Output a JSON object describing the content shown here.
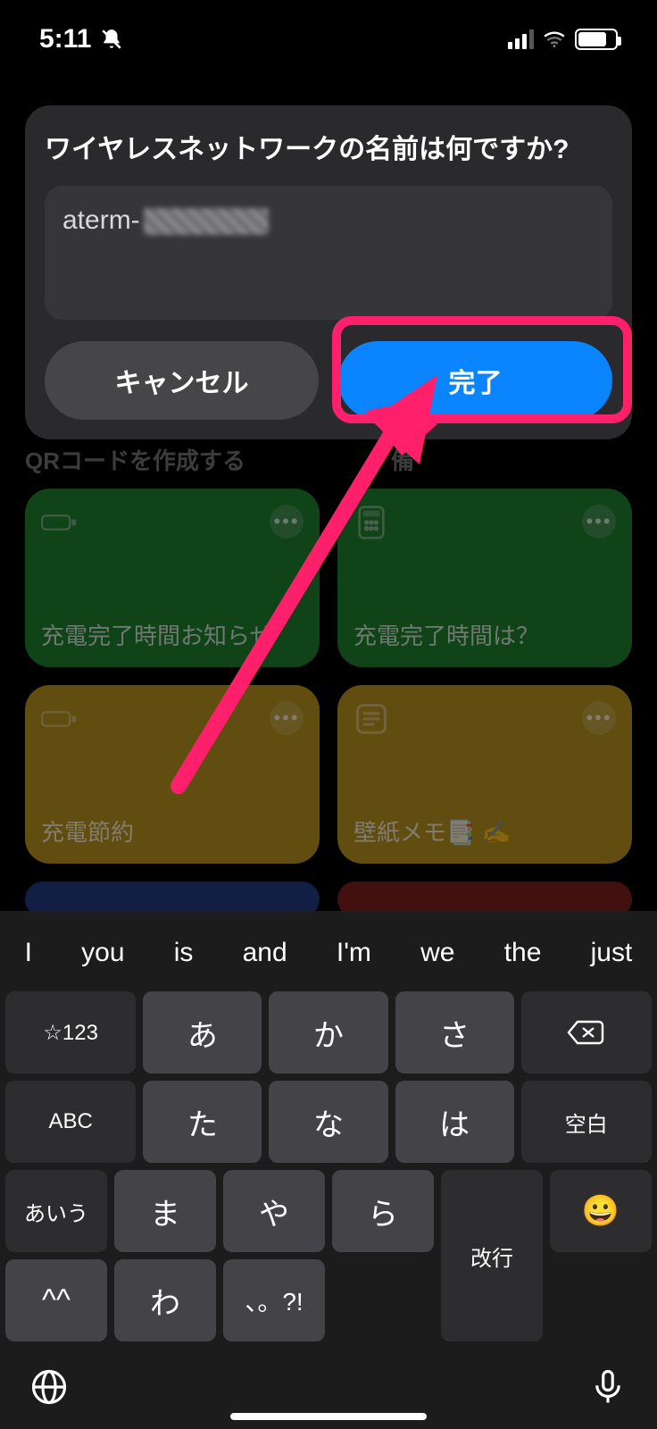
{
  "status": {
    "time": "5:11"
  },
  "background": {
    "label_left": "QRコードを作成する",
    "label_right_suffix": "備",
    "tiles": [
      {
        "title": "充電完了時間お知らせ",
        "color": "green",
        "icon": "battery"
      },
      {
        "title": "充電完了時間は？",
        "color": "green",
        "icon": "calculator"
      },
      {
        "title": "充電節約",
        "color": "yellow",
        "icon": "battery"
      },
      {
        "title": "壁紙メモ📑 ✍️",
        "color": "yellow",
        "icon": "note"
      }
    ]
  },
  "dialog": {
    "title": "ワイヤレスネットワークの名前は何ですか?",
    "input_prefix": "aterm-",
    "cancel": "キャンセル",
    "done": "完了"
  },
  "keyboard": {
    "suggestions": [
      "I",
      "you",
      "is",
      "and",
      "I'm",
      "we",
      "the",
      "just"
    ],
    "rows": [
      [
        "☆123",
        "あ",
        "か",
        "さ",
        "⌫"
      ],
      [
        "ABC",
        "た",
        "な",
        "は",
        "空白"
      ],
      [
        "あいう",
        "ま",
        "や",
        "ら",
        "改行"
      ],
      [
        "😀",
        "^^",
        "わ",
        "、。?!",
        ""
      ]
    ],
    "func": {
      "num": "☆123",
      "abc": "ABC",
      "kana": "あいう",
      "emoji": "😀",
      "space": "空白",
      "enter": "改行"
    }
  }
}
